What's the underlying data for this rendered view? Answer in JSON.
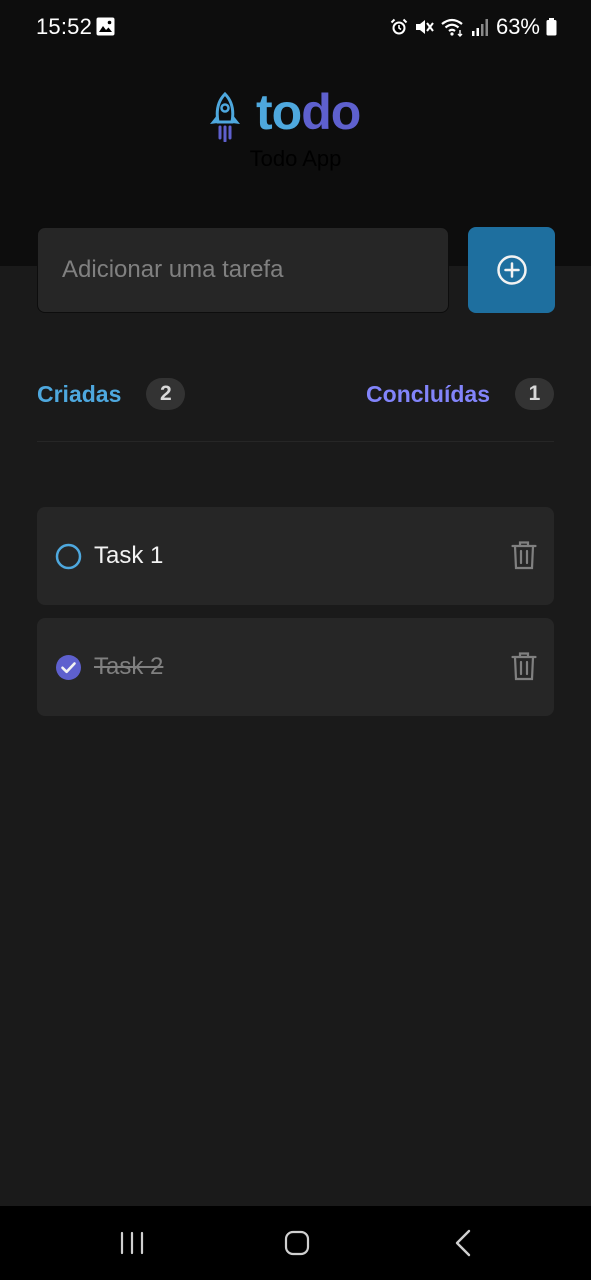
{
  "status_bar": {
    "time": "15:52",
    "battery": "63%",
    "icons": [
      "image-icon",
      "alarm-icon",
      "mute-icon",
      "wifi-icon",
      "signal-icon",
      "battery-icon"
    ]
  },
  "header": {
    "logo_letters": [
      "t",
      "o",
      "d",
      "o"
    ],
    "subtitle": "Todo App"
  },
  "add_task": {
    "placeholder": "Adicionar uma tarefa",
    "value": "",
    "button_icon": "plus-circle-icon"
  },
  "counters": {
    "created_label": "Criadas",
    "created_count": "2",
    "done_label": "Concluídas",
    "done_count": "1"
  },
  "tasks": [
    {
      "title": "Task 1",
      "done": false
    },
    {
      "title": "Task 2",
      "done": true
    }
  ],
  "colors": {
    "blue": "#4ea8de",
    "purple": "#5e60ce",
    "purple_light": "#8284fa",
    "button": "#1e6f9f",
    "card": "#262626",
    "background": "#1a1a1a",
    "header_bg": "#0d0d0d"
  },
  "nav_bar": {
    "icons": [
      "recents-icon",
      "home-icon",
      "back-icon"
    ]
  }
}
